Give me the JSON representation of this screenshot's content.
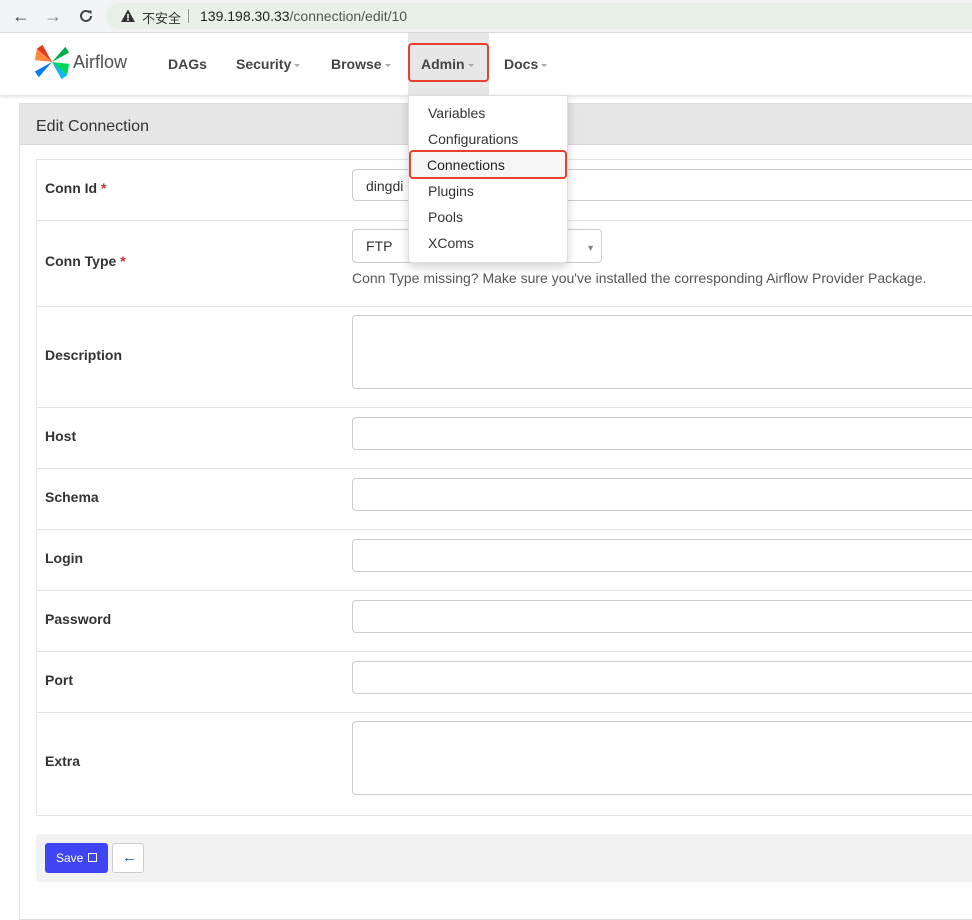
{
  "browser": {
    "security_label": "不安全",
    "url_host": "139.198.30.33",
    "url_path": "/connection/edit/10",
    "back_icon": "←",
    "forward_icon": "→",
    "reload_icon": "C"
  },
  "navbar": {
    "brand": "Airflow",
    "items": [
      {
        "label": "DAGs"
      },
      {
        "label": "Security"
      },
      {
        "label": "Browse"
      },
      {
        "label": "Admin"
      },
      {
        "label": "Docs"
      }
    ]
  },
  "admin_menu": {
    "items": [
      "Variables",
      "Configurations",
      "Connections",
      "Plugins",
      "Pools",
      "XComs"
    ],
    "highlighted": "Connections"
  },
  "panel": {
    "title": "Edit Connection"
  },
  "form": {
    "conn_id": {
      "label": "Conn Id",
      "required": "*",
      "value": "dingdi"
    },
    "conn_type": {
      "label": "Conn Type",
      "required": "*",
      "value": "FTP",
      "help": "Conn Type missing? Make sure you've installed the corresponding Airflow Provider Package."
    },
    "description": {
      "label": "Description",
      "value": ""
    },
    "host": {
      "label": "Host",
      "value": ""
    },
    "schema": {
      "label": "Schema",
      "value": ""
    },
    "login": {
      "label": "Login",
      "value": ""
    },
    "password": {
      "label": "Password",
      "value": ""
    },
    "port": {
      "label": "Port",
      "value": ""
    },
    "extra": {
      "label": "Extra",
      "value": ""
    }
  },
  "actions": {
    "save_label": "Save",
    "back_icon": "🡐"
  },
  "colors": {
    "primary": "#4045f4",
    "highlight": "#e8402f",
    "required": "#c9302c"
  }
}
